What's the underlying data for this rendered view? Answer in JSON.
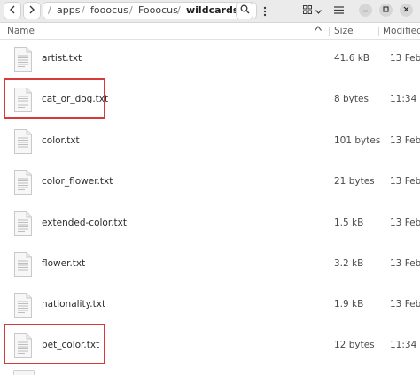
{
  "header": {
    "back_icon": "chevron-left-icon",
    "forward_icon": "chevron-right-icon",
    "breadcrumbs": [
      "apps",
      "fooocus",
      "Fooocus",
      "wildcards"
    ],
    "more_icon": "kebab-menu-icon",
    "search_icon": "search-icon",
    "view_icon": "grid-view-icon",
    "view_dropdown_icon": "chevron-down-icon",
    "menu_icon": "hamburger-menu-icon",
    "minimize_icon": "minimize-icon",
    "maximize_icon": "maximize-icon",
    "close_icon": "close-icon"
  },
  "columns": {
    "name": "Name",
    "size": "Size",
    "modified": "Modified"
  },
  "files": [
    {
      "name": "artist.txt",
      "size": "41.6 kB",
      "modified": "13 Feb",
      "highlighted": false
    },
    {
      "name": "cat_or_dog.txt",
      "size": "8 bytes",
      "modified": "11:34",
      "highlighted": true
    },
    {
      "name": "color.txt",
      "size": "101 bytes",
      "modified": "13 Feb",
      "highlighted": false
    },
    {
      "name": "color_flower.txt",
      "size": "21 bytes",
      "modified": "13 Feb",
      "highlighted": false
    },
    {
      "name": "extended-color.txt",
      "size": "1.5 kB",
      "modified": "13 Feb",
      "highlighted": false
    },
    {
      "name": "flower.txt",
      "size": "3.2 kB",
      "modified": "13 Feb",
      "highlighted": false
    },
    {
      "name": "nationality.txt",
      "size": "1.9 kB",
      "modified": "13 Feb",
      "highlighted": false
    },
    {
      "name": "pet_color.txt",
      "size": "12 bytes",
      "modified": "11:34",
      "highlighted": true
    }
  ],
  "colors": {
    "highlight": "#d63a3a",
    "header_bg": "#ebebeb"
  }
}
